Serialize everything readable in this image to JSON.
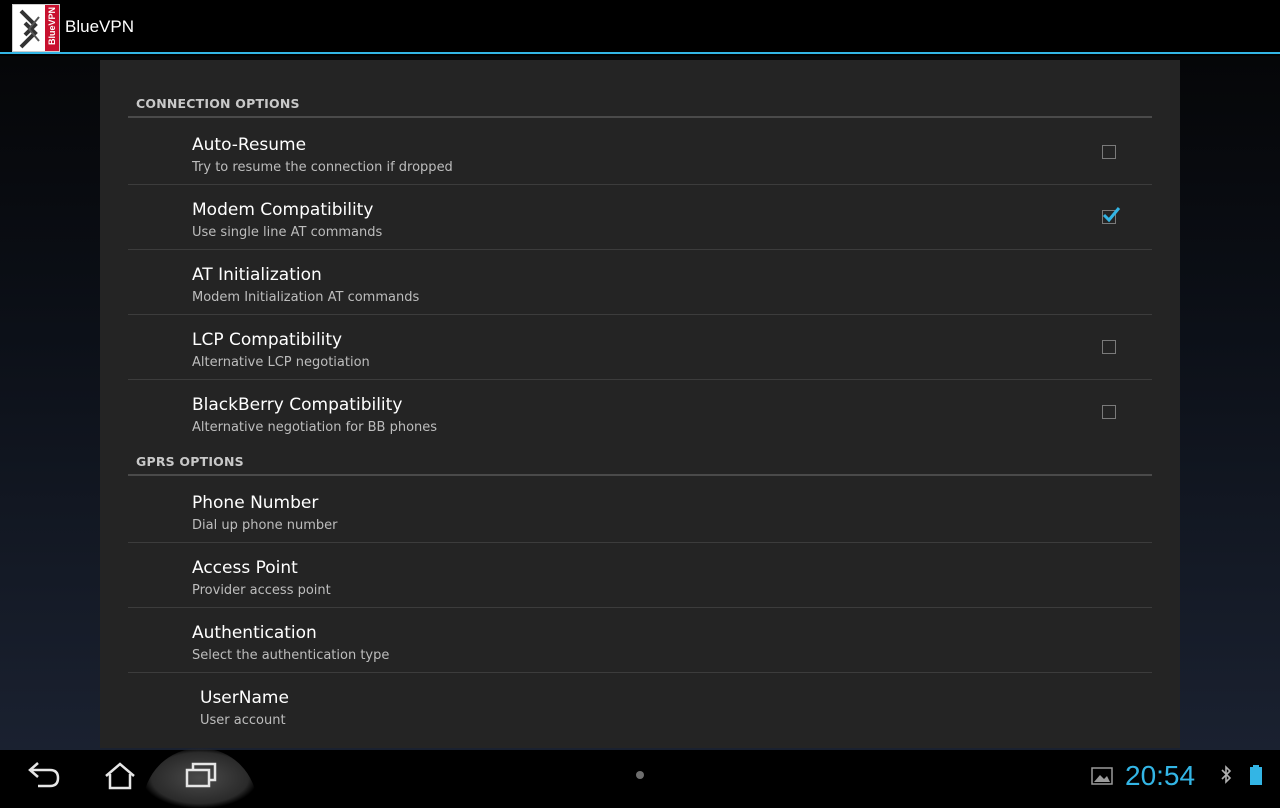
{
  "app": {
    "title": "BlueVPN",
    "logo_text": "BlueVPN"
  },
  "sections": {
    "connection": {
      "header": "CONNECTION OPTIONS",
      "items": [
        {
          "title": "Auto-Resume",
          "summary": "Try to resume the connection if dropped",
          "checkbox": "unchecked"
        },
        {
          "title": "Modem Compatibility",
          "summary": "Use single line AT commands",
          "checkbox": "checked"
        },
        {
          "title": "AT Initialization",
          "summary": "Modem Initialization AT commands",
          "checkbox": "none"
        },
        {
          "title": "LCP Compatibility",
          "summary": "Alternative LCP negotiation",
          "checkbox": "unchecked"
        },
        {
          "title": "BlackBerry Compatibility",
          "summary": "Alternative negotiation for BB phones",
          "checkbox": "unchecked"
        }
      ]
    },
    "gprs": {
      "header": "GPRS OPTIONS",
      "items": [
        {
          "title": "Phone Number",
          "summary": "Dial up phone number"
        },
        {
          "title": "Access Point",
          "summary": "Provider access point"
        },
        {
          "title": "Authentication",
          "summary": "Select the authentication type"
        },
        {
          "title": "UserName",
          "summary": "User account"
        }
      ]
    }
  },
  "status_bar": {
    "clock": "20:54",
    "icons": [
      "gallery-icon",
      "bluetooth-icon",
      "battery-icon"
    ]
  },
  "nav": {
    "buttons": [
      "back-icon",
      "home-icon",
      "recent-apps-icon"
    ]
  },
  "colors": {
    "accent": "#33b5e5",
    "panel": "#242424",
    "logo_red": "#c8102e"
  }
}
